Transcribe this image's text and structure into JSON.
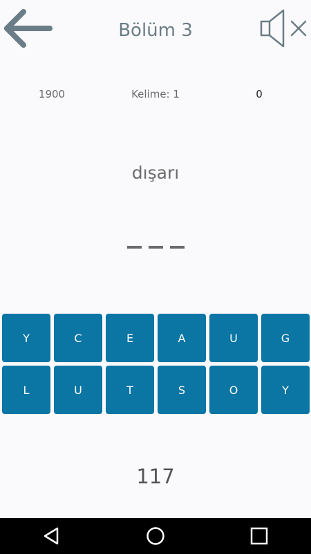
{
  "header": {
    "title": "Bölüm 3",
    "back_icon": "arrow-left-icon",
    "sound_icon": "speaker-muted-icon"
  },
  "stats": {
    "score": "1900",
    "word": "Kelime: 1",
    "count": "0"
  },
  "clue": "dışarı",
  "answer_slots": 3,
  "keys": {
    "row1": [
      "Y",
      "C",
      "E",
      "A",
      "U",
      "G"
    ],
    "row2": [
      "L",
      "U",
      "T",
      "S",
      "O",
      "Y"
    ]
  },
  "remaining": "117",
  "colors": {
    "key_bg": "#0b75a4",
    "icon": "#6b7d86",
    "background": "#fafafc"
  },
  "navbar": {
    "back_icon": "triangle-back-icon",
    "home_icon": "circle-home-icon",
    "recents_icon": "square-recents-icon"
  }
}
